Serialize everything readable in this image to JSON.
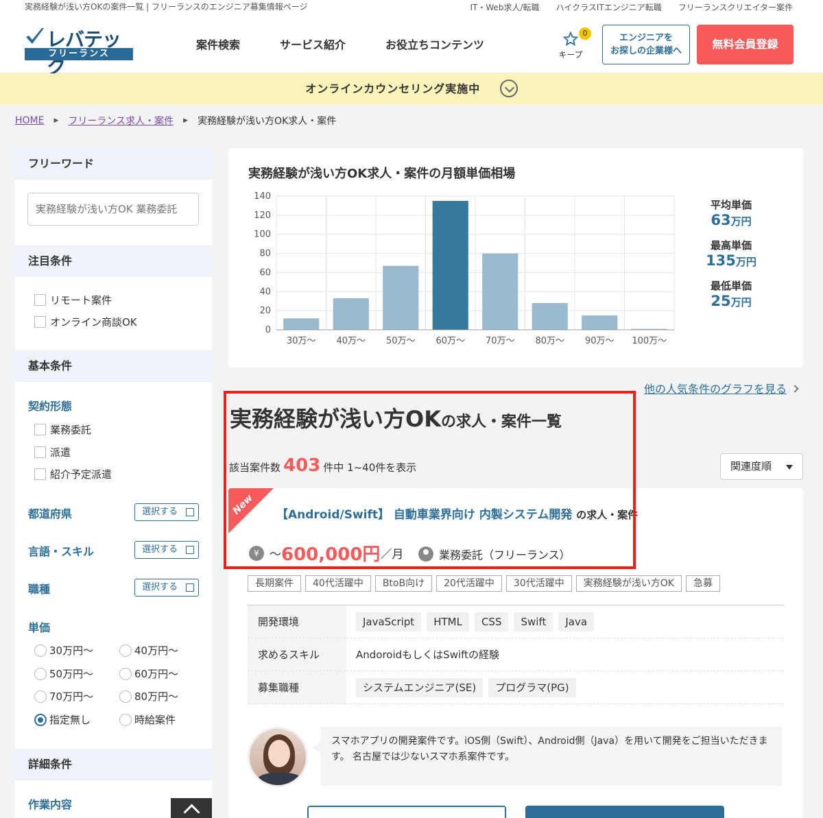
{
  "topbar": {
    "title": "実務経験が浅い方OKの案件一覧 | フリーランスのエンジニア募集情報ページ",
    "links": [
      "IT・Web求人/転職",
      "ハイクラスITエンジニア転職",
      "フリーランスクリエイター案件"
    ]
  },
  "header": {
    "logo_brand": "レバテック",
    "logo_sub": "フリーランス",
    "nav": [
      "案件検索",
      "サービス紹介",
      "お役立ちコンテンツ"
    ],
    "keep_label": "キープ",
    "keep_count": "0",
    "company_button_line1": "エンジニアを",
    "company_button_line2": "お探しの企業様へ",
    "register_button": "無料会員登録"
  },
  "banner": {
    "text": "オンラインカウンセリング実施中"
  },
  "breadcrumb": {
    "home": "HOME",
    "level1": "フリーランス求人・案件",
    "current": "実務経験が浅い方OK求人・案件"
  },
  "sidebar": {
    "freeword_heading": "フリーワード",
    "freeword_value": "実務経験が浅い方OK 業務委託",
    "focus_heading": "注目条件",
    "focus_options": [
      "リモート案件",
      "オンライン商談OK"
    ],
    "basic_heading": "基本条件",
    "contract_heading": "契約形態",
    "contract_options": [
      "業務委託",
      "派遣",
      "紹介予定派遣"
    ],
    "prefecture_heading": "都道府県",
    "skill_heading": "言語・スキル",
    "job_type_heading": "職種",
    "select_button": "選択する",
    "price_heading": "単価",
    "price_options": [
      "30万円〜",
      "40万円〜",
      "50万円〜",
      "60万円〜",
      "70万円〜",
      "80万円〜",
      "指定無し",
      "時給案件"
    ],
    "price_selected": "指定無し",
    "detail_heading": "詳細条件",
    "work_heading": "作業内容"
  },
  "chart_card": {
    "title": "実務経験が浅い方OK求人・案件の月額単価相場",
    "stats": [
      {
        "label": "平均単価",
        "value": "63",
        "unit": "万円"
      },
      {
        "label": "最高単価",
        "value": "135",
        "unit": "万円"
      },
      {
        "label": "最低単価",
        "value": "25",
        "unit": "万円"
      }
    ],
    "colors": {
      "bar": "#9bbacd",
      "bar_highlight": "#36799d"
    }
  },
  "chart_data": {
    "type": "bar",
    "categories": [
      "30万〜",
      "40万〜",
      "50万〜",
      "60万〜",
      "70万〜",
      "80万〜",
      "90万〜",
      "100万〜"
    ],
    "values": [
      12,
      33,
      67,
      135,
      80,
      28,
      15,
      1
    ],
    "highlight_index": 3,
    "yticks": [
      0,
      20,
      40,
      60,
      80,
      100,
      120,
      140
    ],
    "ylim": [
      0,
      140
    ],
    "grid": true,
    "title": "",
    "xlabel": "",
    "ylabel": ""
  },
  "more_link": "他の人気条件のグラフを見る",
  "listing": {
    "title_main": "実務経験が浅い方OK",
    "title_suffix": "の求人・案件一覧",
    "count_prefix": "該当案件数",
    "count": "403",
    "count_suffix": "件中 1~40件を表示",
    "sort_label": "関連度順"
  },
  "job": {
    "new_label": "New",
    "title": "【Android/Swift】 自動車業界向け 内製システム開発",
    "title_suffix": "の求人・案件",
    "price_prefix": "〜",
    "price": "600,000円",
    "price_unit": "／月",
    "contract": "業務委託（フリーランス）",
    "tags": [
      "長期案件",
      "40代活躍中",
      "BtoB向け",
      "20代活躍中",
      "30代活躍中",
      "実務経験が浅い方OK",
      "急募"
    ],
    "env_label": "開発環境",
    "env": [
      "JavaScript",
      "HTML",
      "CSS",
      "Swift",
      "Java"
    ],
    "skill_label": "求めるスキル",
    "skill": "AndoroidもしくはSwiftの経験",
    "role_label": "募集職種",
    "roles": [
      "システムエンジニア(SE)",
      "プログラマ(PG)"
    ],
    "comment": "スマホアプリの開発案件です。iOS側（Swift）、Android側（Java）を用いて開発をご担当いただきます。 名古屋では少ないスマホ系案件です。"
  }
}
